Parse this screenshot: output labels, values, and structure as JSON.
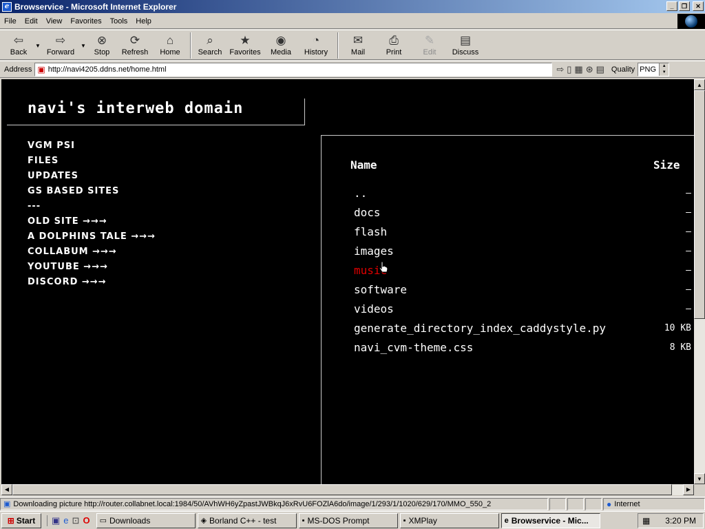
{
  "window": {
    "title": "Browservice - Microsoft Internet Explorer",
    "buttons": [
      "_",
      "❐",
      "✕"
    ]
  },
  "menu": {
    "items": [
      "File",
      "Edit",
      "View",
      "Favorites",
      "Tools",
      "Help"
    ]
  },
  "toolbar": {
    "back": "Back",
    "forward": "Forward",
    "stop": "Stop",
    "refresh": "Refresh",
    "home": "Home",
    "search": "Search",
    "favorites": "Favorites",
    "media": "Media",
    "history": "History",
    "mail": "Mail",
    "print": "Print",
    "edit": "Edit",
    "discuss": "Discuss"
  },
  "address": {
    "label": "Address",
    "url": "http://navi4205.ddns.net/home.html",
    "quality_label": "Quality",
    "quality_value": "PNG"
  },
  "page": {
    "site_title": "navi's interweb domain",
    "nav": [
      "VGM PSI",
      "FILES",
      "UPDATES",
      "GS BASED SITES",
      "---",
      "OLD SITE →→→",
      "A DOLPHINS TALE →→→",
      "COLLABUM →→→",
      "YOUTUBE →→→",
      "DISCORD →→→"
    ],
    "listing": {
      "col_name": "Name",
      "col_size": "Size",
      "rows": [
        {
          "name": "..",
          "size": "—"
        },
        {
          "name": "docs",
          "size": "—"
        },
        {
          "name": "flash",
          "size": "—"
        },
        {
          "name": "images",
          "size": "—"
        },
        {
          "name": "music",
          "size": "—"
        },
        {
          "name": "software",
          "size": "—"
        },
        {
          "name": "videos",
          "size": "—"
        },
        {
          "name": "generate_directory_index_caddystyle.py",
          "size": "10 KB"
        },
        {
          "name": "navi_cvm-theme.css",
          "size": "8 KB"
        }
      ],
      "highlight_color": "#e00000"
    }
  },
  "status": {
    "text": "Downloading picture http://router.collabnet.local:1984/50/AVhWH6yZpastJWBkqJ6xRvU6FOZlA6do/image/1/293/1/1020/629/170/MMO_550_2",
    "zone": "Internet"
  },
  "taskbar": {
    "start": "Start",
    "tasks": [
      "Downloads",
      "Borland C++ - test",
      "MS-DOS Prompt",
      "XMPlay",
      "Browservice - Mic..."
    ],
    "clock": "3:20 PM"
  }
}
